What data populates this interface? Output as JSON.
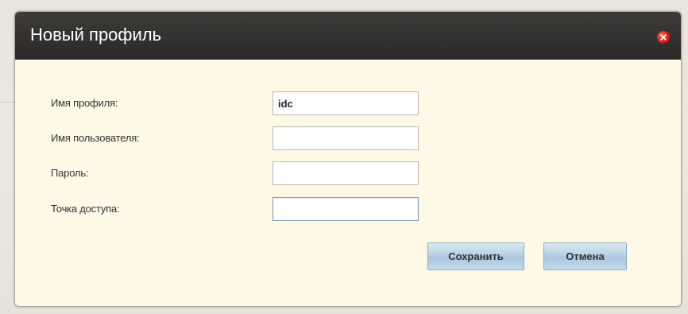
{
  "dialog": {
    "title": "Новый профиль",
    "close_icon": "close-icon"
  },
  "form": {
    "profile_name": {
      "label": "Имя профиля:",
      "value": "idc"
    },
    "username": {
      "label": "Имя пользователя:",
      "value": ""
    },
    "password": {
      "label": "Пароль:",
      "value": ""
    },
    "access_point": {
      "label": "Точка доступа:",
      "value": ""
    }
  },
  "buttons": {
    "save_label": "Сохранить",
    "cancel_label": "Отмена"
  },
  "colors": {
    "titlebar": "#2f2e2c",
    "dialog_body": "#fdf9e6",
    "button_face": "#b6d0e4",
    "close_button": "#d11b10"
  }
}
